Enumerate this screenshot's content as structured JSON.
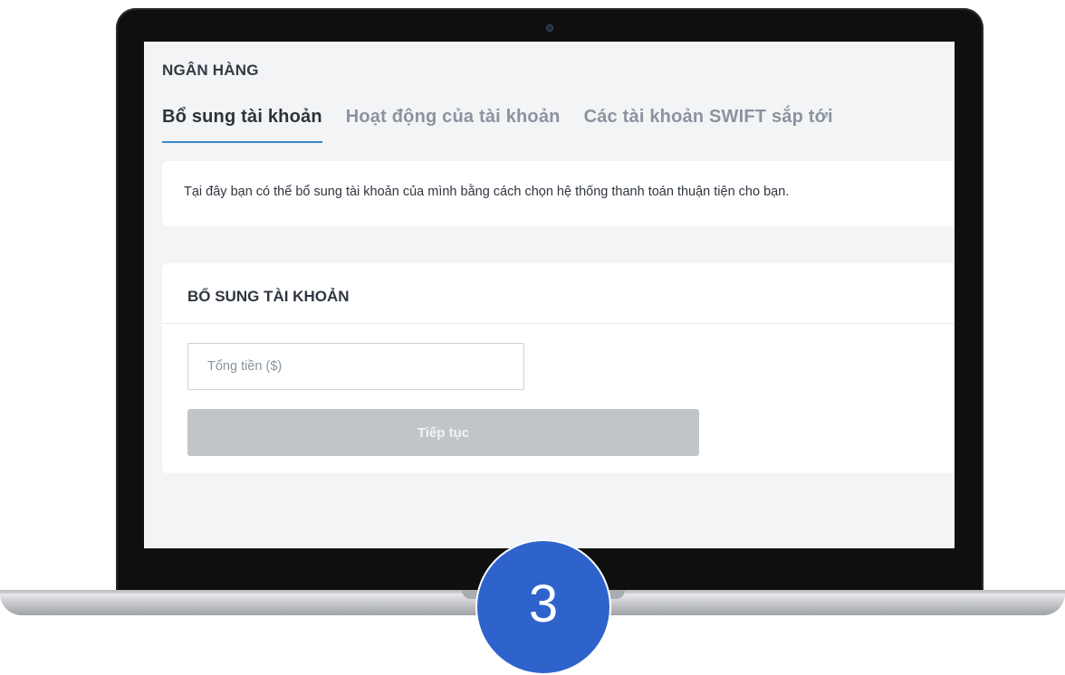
{
  "section_title": "NGÂN HÀNG",
  "tabs": [
    {
      "label": "Bổ sung tài khoản",
      "active": true
    },
    {
      "label": "Hoạt động của tài khoản",
      "active": false
    },
    {
      "label": "Các tài khoản SWIFT sắp tới",
      "active": false
    }
  ],
  "info": {
    "text": "Tại đây bạn có thể bổ sung tài khoản của mình bằng cách chọn hệ thống thanh toán thuận tiện cho bạn."
  },
  "form": {
    "title": "BỔ SUNG TÀI KHOẢN",
    "amount_placeholder": "Tổng tiền ($)",
    "amount_value": "",
    "continue_label": "Tiếp tục"
  },
  "step_badge": {
    "number": "3"
  },
  "colors": {
    "accent": "#3b87c4",
    "badge": "#2f63cc",
    "button_disabled": "#c2c5c8",
    "screen_bg": "#f3f4f6"
  }
}
